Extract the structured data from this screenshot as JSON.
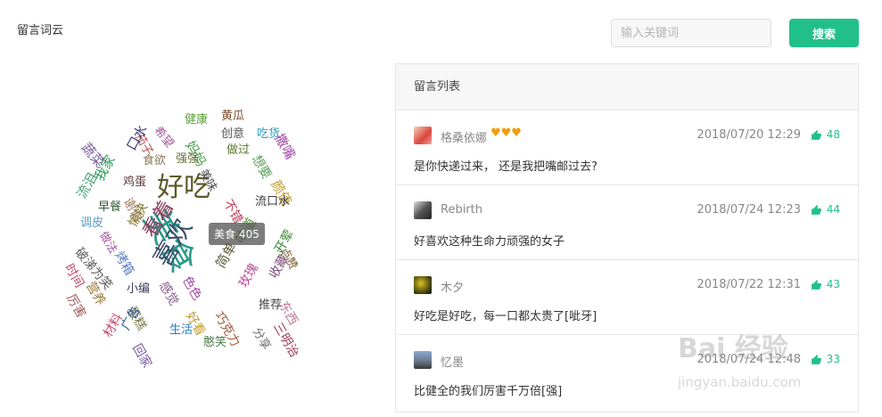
{
  "page": {
    "title": "留言词云"
  },
  "search": {
    "placeholder": "输入关键词",
    "button_label": "搜索"
  },
  "cloud": {
    "tooltip": "美食 405",
    "words": [
      {
        "text": "好吃",
        "color": "#5a5a2a"
      },
      {
        "text": "美食",
        "color": "#2a9a8a"
      },
      {
        "text": "喜欢",
        "color": "#3a4a6a"
      },
      {
        "text": "看着",
        "color": "#8a3a5a"
      },
      {
        "text": "健康",
        "color": "#5aa03a"
      },
      {
        "text": "黄瓜",
        "color": "#7a4a2a"
      },
      {
        "text": "希望",
        "color": "#a05a9a"
      },
      {
        "text": "创意",
        "color": "#555555"
      },
      {
        "text": "吃货",
        "color": "#2aa0c0"
      },
      {
        "text": "妈妈",
        "color": "#4aa04a"
      },
      {
        "text": "茄子",
        "color": "#c04a4a"
      },
      {
        "text": "做过",
        "color": "#5a7a2a"
      },
      {
        "text": "撒嘴",
        "color": "#a04aa0"
      },
      {
        "text": "蔬菜",
        "color": "#7a5a9a"
      },
      {
        "text": "口水",
        "color": "#3a3a7a"
      },
      {
        "text": "食欲",
        "color": "#8a7a5a"
      },
      {
        "text": "强强",
        "color": "#6a6a3a"
      },
      {
        "text": "想要",
        "color": "#5aa05a"
      },
      {
        "text": "颜值",
        "color": "#c09a2a"
      },
      {
        "text": "美味",
        "color": "#4a4a4a"
      },
      {
        "text": "我家",
        "color": "#2a9a5a"
      },
      {
        "text": "鸡蛋",
        "color": "#5a3a3a"
      },
      {
        "text": "流口水",
        "color": "#3a3a3a"
      },
      {
        "text": "流泪",
        "color": "#4aa07a"
      },
      {
        "text": "早餐",
        "color": "#3a5a3a"
      },
      {
        "text": "谢谢",
        "color": "#a07a5a"
      },
      {
        "text": "不错",
        "color": "#c03a5a"
      },
      {
        "text": "调皮",
        "color": "#5a9ac0"
      },
      {
        "text": "愉快",
        "color": "#7a7a2a"
      },
      {
        "text": "做法",
        "color": "#a05aa0"
      },
      {
        "text": "点赞",
        "color": "#7a5a2a"
      },
      {
        "text": "破涕为笑",
        "color": "#5a5a5a"
      },
      {
        "text": "烤箱",
        "color": "#5a7ac0"
      },
      {
        "text": "味道",
        "color": "#5a9a3a"
      },
      {
        "text": "开荤",
        "color": "#3a8a3a"
      },
      {
        "text": "时间",
        "color": "#c04a6a"
      },
      {
        "text": "简单",
        "color": "#5a5a3a"
      },
      {
        "text": "小编",
        "color": "#3a3a5a"
      },
      {
        "text": "营养",
        "color": "#9a7a3a"
      },
      {
        "text": "收藏",
        "color": "#7a4a7a"
      },
      {
        "text": "厉害",
        "color": "#a05a5a"
      },
      {
        "text": "色色",
        "color": "#a04aa0"
      },
      {
        "text": "感觉",
        "color": "#8a5a8a"
      },
      {
        "text": "玫瑰",
        "color": "#c04a9a"
      },
      {
        "text": "东西",
        "color": "#c07a9a"
      },
      {
        "text": "推荐",
        "color": "#4a4a4a"
      },
      {
        "text": "蛋糕",
        "color": "#7a7a4a"
      },
      {
        "text": "好看",
        "color": "#c09a2a"
      },
      {
        "text": "巧克力",
        "color": "#a05a3a"
      },
      {
        "text": "三明治",
        "color": "#9a3a5a"
      },
      {
        "text": "广告",
        "color": "#2a5aa0"
      },
      {
        "text": "生活",
        "color": "#2a7ac0"
      },
      {
        "text": "分享",
        "color": "#6a6a6a"
      },
      {
        "text": "材料",
        "color": "#c04a6a"
      },
      {
        "text": "回家",
        "color": "#7a5aa0"
      },
      {
        "text": "憨笑",
        "color": "#4a7a4a"
      }
    ]
  },
  "panel": {
    "title": "留言列表",
    "items": [
      {
        "user": "格桑依娜",
        "hearts": "♥♥♥",
        "date": "2018/07/20 12:29",
        "likes": "48",
        "message": "是你快递过来， 还是我把嘴邮过去?"
      },
      {
        "user": "Rebirth",
        "hearts": "",
        "date": "2018/07/24 12:23",
        "likes": "44",
        "message": "好喜欢这种生命力顽强的女子"
      },
      {
        "user": "木夕",
        "hearts": "",
        "date": "2018/07/22 12:31",
        "likes": "43",
        "message": "好吃是好吃，每一口都太贵了[呲牙]"
      },
      {
        "user": "忆墨",
        "hearts": "",
        "date": "2018/07/24 12:48",
        "likes": "33",
        "message": "比健全的我们厉害千万倍[强]"
      }
    ]
  }
}
